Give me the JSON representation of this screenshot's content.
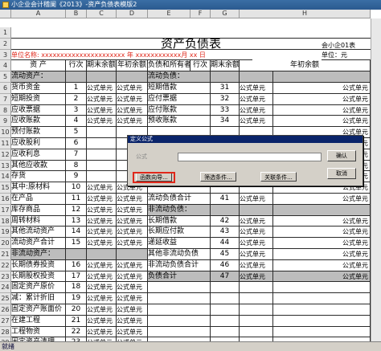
{
  "window": {
    "title": "小企业会计稽阑《2013》-资产负债表模版2"
  },
  "columns": [
    "A",
    "B",
    "C",
    "D",
    "E",
    "F",
    "G",
    "H"
  ],
  "rows": [
    "1",
    "2",
    "3",
    "4",
    "5",
    "6",
    "7",
    "8",
    "9",
    "10",
    "11",
    "12",
    "13",
    "14",
    "15",
    "16",
    "17",
    "18",
    "19",
    "20",
    "21",
    "22",
    "23",
    "24",
    "25",
    "26",
    "27",
    "28",
    "29"
  ],
  "sheet": {
    "title": "资产负债表",
    "form_code": "会小企01表",
    "unit_label": "单位名称: xxxxxxxxxxxxxxxxxxxxxx 年 xxxxxxxxxxxx月  xx 日",
    "unit": "单位：元",
    "headers": [
      "资  产",
      "行次",
      "期末余额",
      "年初余额",
      "负债和所有者权益",
      "行次",
      "期末余额",
      "年初余额"
    ],
    "left_rows": [
      {
        "name": "流动资产：",
        "no": "",
        "a": "",
        "b": "",
        "gray": true
      },
      {
        "name": "  货币资金",
        "no": "1",
        "a": "公式单元",
        "b": "公式单元"
      },
      {
        "name": "  短期投资",
        "no": "2",
        "a": "公式单元",
        "b": "公式单元"
      },
      {
        "name": "  应收票据",
        "no": "3",
        "a": "公式单元",
        "b": "公式单元"
      },
      {
        "name": "  应收账款",
        "no": "4",
        "a": "公式单元",
        "b": "公式单元"
      },
      {
        "name": "  预付账款",
        "no": "5",
        "a": "",
        "b": ""
      },
      {
        "name": "  应收股利",
        "no": "6",
        "a": "",
        "b": ""
      },
      {
        "name": "  应收利息",
        "no": "7",
        "a": "",
        "b": ""
      },
      {
        "name": "  其他应收款",
        "no": "8",
        "a": "",
        "b": ""
      },
      {
        "name": "  存货",
        "no": "9",
        "a": "",
        "b": ""
      },
      {
        "name": "其中:原材料",
        "no": "10",
        "a": "公式单元",
        "b": "公式单元"
      },
      {
        "name": "      在产品",
        "no": "11",
        "a": "公式单元",
        "b": "公式单元"
      },
      {
        "name": "      库存商品",
        "no": "12",
        "a": "公式单元",
        "b": "公式单元"
      },
      {
        "name": "      周转材料",
        "no": "13",
        "a": "公式单元",
        "b": "公式单元"
      },
      {
        "name": "  其他流动资产",
        "no": "14",
        "a": "公式单元",
        "b": "公式单元"
      },
      {
        "name": "流动资产合计",
        "no": "15",
        "a": "公式单元",
        "b": "公式单元"
      },
      {
        "name": "非流动资产：",
        "no": "",
        "a": "",
        "b": "",
        "gray": true
      },
      {
        "name": "  长期债券投资",
        "no": "16",
        "a": "公式单元",
        "b": "公式单元"
      },
      {
        "name": "  长期股权投资",
        "no": "17",
        "a": "公式单元",
        "b": "公式单元"
      },
      {
        "name": "  固定资产原价",
        "no": "18",
        "a": "公式单元",
        "b": "公式单元"
      },
      {
        "name": "减：累计折旧",
        "no": "19",
        "a": "公式单元",
        "b": "公式单元"
      },
      {
        "name": "  固定资产账面价",
        "no": "20",
        "a": "公式单元",
        "b": "公式单元"
      },
      {
        "name": "  在建工程",
        "no": "21",
        "a": "公式单元",
        "b": "公式单元"
      },
      {
        "name": "  工程物资",
        "no": "22",
        "a": "公式单元",
        "b": "公式单元"
      },
      {
        "name": "  固定资产清理",
        "no": "23",
        "a": "公式单元",
        "b": "公式单元"
      }
    ],
    "right_rows": [
      {
        "name": "流动负债：",
        "no": "",
        "a": "",
        "b": "",
        "gray": true
      },
      {
        "name": "  短期借款",
        "no": "31",
        "a": "公式单元",
        "b": "公式单元"
      },
      {
        "name": "  应付票据",
        "no": "32",
        "a": "公式单元",
        "b": "公式单元"
      },
      {
        "name": "  应付账款",
        "no": "33",
        "a": "公式单元",
        "b": "公式单元"
      },
      {
        "name": "  预收账款",
        "no": "34",
        "a": "公式单元",
        "b": "公式单元"
      },
      {
        "name": "",
        "no": "",
        "a": "",
        "b": "公式单元"
      },
      {
        "name": "",
        "no": "",
        "a": "",
        "b": "公式单元"
      },
      {
        "name": "",
        "no": "",
        "a": "",
        "b": "公式单元"
      },
      {
        "name": "",
        "no": "",
        "a": "",
        "b": "公式单元"
      },
      {
        "name": "",
        "no": "",
        "a": "",
        "b": "公式单元"
      },
      {
        "name": "",
        "no": "",
        "a": "",
        "b": "公式单元"
      },
      {
        "name": "流动负债合计",
        "no": "41",
        "a": "公式单元",
        "b": "公式单元"
      },
      {
        "name": "非流动负债：",
        "no": "",
        "a": "",
        "b": "",
        "gray": true
      },
      {
        "name": "  长期借款",
        "no": "42",
        "a": "公式单元",
        "b": "公式单元"
      },
      {
        "name": "  长期应付款",
        "no": "43",
        "a": "公式单元",
        "b": "公式单元"
      },
      {
        "name": "  递延收益",
        "no": "44",
        "a": "公式单元",
        "b": "公式单元"
      },
      {
        "name": "  其他非流动负债",
        "no": "45",
        "a": "公式单元",
        "b": "公式单元"
      },
      {
        "name": "  非流动负债合计",
        "no": "46",
        "a": "公式单元",
        "b": "公式单元"
      },
      {
        "name": "负债合计",
        "no": "47",
        "a": "公式单元",
        "b": "公式单元",
        "gray": true
      },
      {
        "name": "",
        "no": "",
        "a": "",
        "b": ""
      },
      {
        "name": "",
        "no": "",
        "a": "",
        "b": ""
      },
      {
        "name": "",
        "no": "",
        "a": "",
        "b": ""
      },
      {
        "name": "",
        "no": "",
        "a": "",
        "b": ""
      },
      {
        "name": "",
        "no": "",
        "a": "",
        "b": ""
      },
      {
        "name": "",
        "no": "",
        "a": "",
        "b": ""
      }
    ]
  },
  "dialog": {
    "title": "定义公式",
    "field_label": "公式",
    "formula_value": "",
    "ok": "确认",
    "cancel": "取消",
    "func_wizard": "函数向导...",
    "filter": "筛选条件...",
    "relation": "关联条件..."
  },
  "status": {
    "text": "就绪"
  }
}
